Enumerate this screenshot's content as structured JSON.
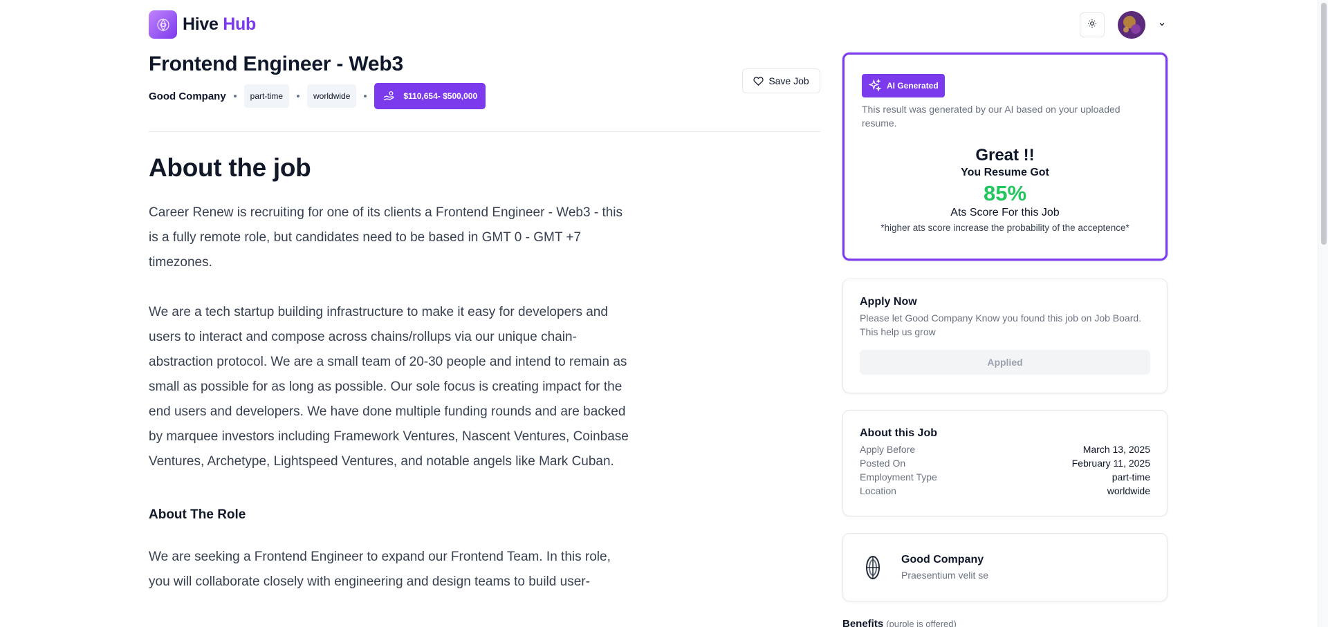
{
  "brand": {
    "name_part1": "Hive",
    "name_part2": "Hub"
  },
  "header": {
    "theme_icon": "sun-icon",
    "menu_icon": "chevron-down-icon"
  },
  "job": {
    "title": "Frontend Engineer - Web3",
    "company": "Good Company",
    "employment_type": "part-time",
    "location": "worldwide",
    "salary": "$110,654- $500,000",
    "save_label": "Save Job"
  },
  "content": {
    "heading": "About the job",
    "paragraph1": "Career Renew is recruiting for one of its clients a Frontend Engineer - Web3 - this is a fully remote role, but candidates need to be based in GMT 0 - GMT +7 timezones.",
    "paragraph2": "We are a tech startup building infrastructure to make it easy for developers and users to interact and compose across chains/rollups via our unique chain-abstraction protocol. We are a small team of 20-30 people and intend to remain as small as possible for as long as possible. Our sole focus is creating impact for the end users and developers. We have done multiple funding rounds and are backed by marquee investors including Framework Ventures, Nascent Ventures, Coinbase Ventures, Archetype, Lightspeed Ventures, and notable angels like Mark Cuban.",
    "role_heading": "About The Role",
    "paragraph3": "We are seeking a Frontend Engineer to expand our Frontend Team. In this role, you will collaborate closely with engineering and design teams to build user-"
  },
  "ai": {
    "badge": "AI Generated",
    "note": "This result was generated by our AI based on your uploaded resume.",
    "great": "Great !!",
    "got": "You Resume Got",
    "score": "85%",
    "ats": "Ats Score For this Job",
    "hint": "*higher ats score increase the probability of the acceptence*"
  },
  "apply": {
    "title": "Apply Now",
    "subtitle": "Please let Good Company Know you found this job on Job Board. This help us grow",
    "button": "Applied"
  },
  "about_job": {
    "title": "About this Job",
    "rows": [
      {
        "label": "Apply Before",
        "value": "March 13, 2025"
      },
      {
        "label": "Posted On",
        "value": "February 11, 2025"
      },
      {
        "label": "Employment Type",
        "value": "part-time"
      },
      {
        "label": "Location",
        "value": "worldwide"
      }
    ]
  },
  "company_card": {
    "name": "Good Company",
    "subtitle": "Praesentium velit se"
  },
  "benefits": {
    "title": "Benefits",
    "note": "(purple is offered)"
  },
  "colors": {
    "accent": "#7c3aed",
    "score": "#22c55e"
  }
}
